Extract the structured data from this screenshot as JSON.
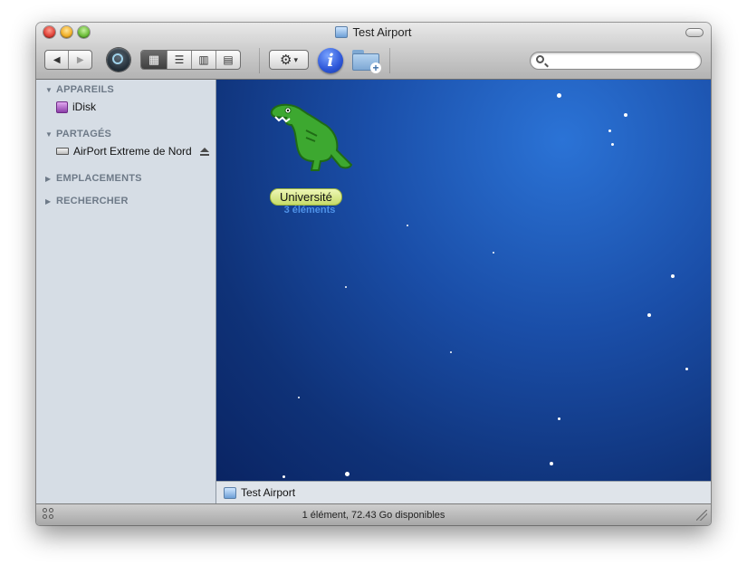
{
  "window": {
    "title": "Test Airport"
  },
  "toolbar": {
    "nav_back": "◀",
    "nav_forward": "▶",
    "view_icon": "▦",
    "view_list": "☰",
    "view_column": "▥",
    "view_coverflow": "▤",
    "action_gear": "⚙",
    "action_chevron": "▾",
    "info": "i",
    "new_folder_plus": "+",
    "search_placeholder": ""
  },
  "sidebar": {
    "sections": [
      {
        "label": "APPAREILS",
        "expanded": true,
        "items": [
          {
            "label": "iDisk",
            "icon": "idisk-icon"
          }
        ]
      },
      {
        "label": "PARTAGÉS",
        "expanded": true,
        "items": [
          {
            "label": "AirPort Extreme de Nord",
            "icon": "server-drive-icon",
            "eject": true
          }
        ]
      },
      {
        "label": "EMPLACEMENTS",
        "expanded": false,
        "items": []
      },
      {
        "label": "RECHERCHER",
        "expanded": false,
        "items": []
      }
    ],
    "expanded_marker": "▼",
    "collapsed_marker": "▶"
  },
  "content": {
    "file": {
      "name": "Université",
      "subtitle": "3 éléments",
      "label_color": "#c7dc6a",
      "icon": "dinosaur-icon"
    }
  },
  "pathbar": {
    "label": "Test Airport"
  },
  "status": {
    "text": "1 élément, 72.43 Go disponibles"
  }
}
